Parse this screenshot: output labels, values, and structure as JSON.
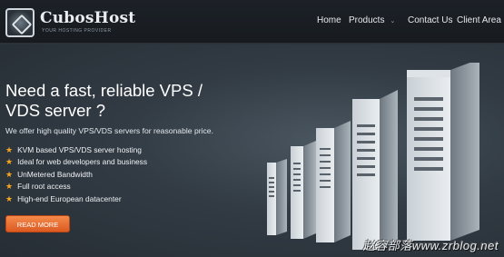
{
  "brand": {
    "name": "CubosHost",
    "tagline": "YOUR HOSTING PROVIDER"
  },
  "nav": {
    "items": [
      {
        "label": "Home"
      },
      {
        "label": "Products"
      },
      {
        "label": "Contact Us"
      },
      {
        "label": "Client Area"
      }
    ],
    "dropdown_icon": "chevron-down-icon"
  },
  "hero": {
    "headline": "Need a fast, reliable VPS / VDS server ?",
    "subline": "We offer high quality VPS/VDS servers for reasonable price.",
    "features": [
      "KVM based VPS/VDS server hosting",
      "Ideal for web developers and business",
      "UnMetered Bandwidth",
      "Full root access",
      "High-end European datacenter"
    ],
    "feature_icon": "star-icon",
    "cta_label": "READ MORE"
  },
  "watermark": "赵容部落www.zrblog.net",
  "colors": {
    "header_bg": "#1a1f24",
    "hero_bg": "#323b44",
    "accent": "#f0793a",
    "star": "#f6a623"
  }
}
